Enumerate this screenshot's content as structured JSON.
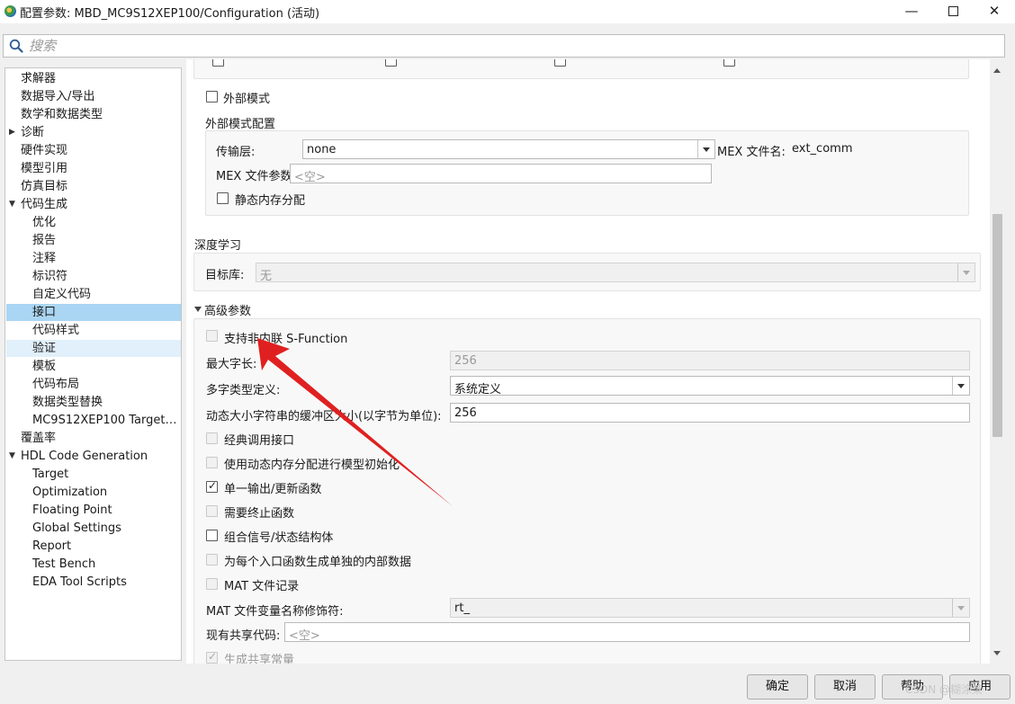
{
  "window": {
    "title": "配置参数: MBD_MC9S12XEP100/Configuration (活动)"
  },
  "search": {
    "placeholder": "搜索"
  },
  "tree": {
    "items": [
      {
        "label": "求解器"
      },
      {
        "label": "数据导入/导出"
      },
      {
        "label": "数学和数据类型"
      },
      {
        "label": "诊断",
        "expander": "collapsed"
      },
      {
        "label": "硬件实现"
      },
      {
        "label": "模型引用"
      },
      {
        "label": "仿真目标"
      },
      {
        "label": "代码生成",
        "expander": "expanded"
      },
      {
        "label": "优化"
      },
      {
        "label": "报告"
      },
      {
        "label": "注释"
      },
      {
        "label": "标识符"
      },
      {
        "label": "自定义代码"
      },
      {
        "label": "接口",
        "state": "selected"
      },
      {
        "label": "代码样式"
      },
      {
        "label": "验证",
        "state": "hover"
      },
      {
        "label": "模板"
      },
      {
        "label": "代码布局"
      },
      {
        "label": "数据类型替换"
      },
      {
        "label": "MC9S12XEP100 Target ..."
      },
      {
        "label": "覆盖率"
      },
      {
        "label": "HDL Code Generation",
        "expander": "expanded"
      },
      {
        "label": "Target"
      },
      {
        "label": "Optimization"
      },
      {
        "label": "Floating Point"
      },
      {
        "label": "Global Settings"
      },
      {
        "label": "Report"
      },
      {
        "label": "Test Bench"
      },
      {
        "label": "EDA Tool Scripts"
      }
    ]
  },
  "external_mode": {
    "checkbox_label": "外部模式",
    "checked": false,
    "config_title": "外部模式配置",
    "transport_label": "传输层:",
    "transport_value": "none",
    "mex_name_label": "MEX 文件名:",
    "mex_name_value": "ext_comm",
    "mex_args_label": "MEX 文件参数:",
    "mex_args_placeholder": "<空>",
    "static_mem_label": "静态内存分配",
    "static_mem_checked": false
  },
  "deep_learning": {
    "title": "深度学习",
    "target_lib_label": "目标库:",
    "target_lib_value": "无"
  },
  "advanced": {
    "title": "高级参数",
    "support_sfunc_label": "支持非内联 S-Function",
    "max_ident_label": "最大字长:",
    "max_ident_value": "256",
    "multiword_label": "多字类型定义:",
    "multiword_value": "系统定义",
    "dyn_buf_label": "动态大小字符串的缓冲区大小(以字节为单位):",
    "dyn_buf_value": "256",
    "classic_iface_label": "经典调用接口",
    "dyn_mem_init_label": "使用动态内存分配进行模型初始化",
    "single_output_label": "单一输出/更新函数",
    "single_output_checked": true,
    "terminate_label": "需要终止函数",
    "combine_label": "组合信号/状态结构体",
    "combine_checked": false,
    "per_entry_label": "为每个入口函数生成单独的内部数据",
    "mat_logging_label": "MAT 文件记录",
    "mat_var_label": "MAT 文件变量名称修饰符:",
    "mat_var_value": "rt_",
    "shared_code_label": "现有共享代码:",
    "shared_code_placeholder": "<空>",
    "shared_const_label": "生成共享常量",
    "shared_const_checked": true
  },
  "buttons": {
    "ok": "确定",
    "cancel": "取消",
    "help": "帮助",
    "apply": "应用"
  },
  "watermark": "CSDN @糊涂某",
  "colors": {
    "selected": "#aad5f3",
    "hover": "#e1f0fb",
    "annotation_arrow": "#e02020"
  }
}
